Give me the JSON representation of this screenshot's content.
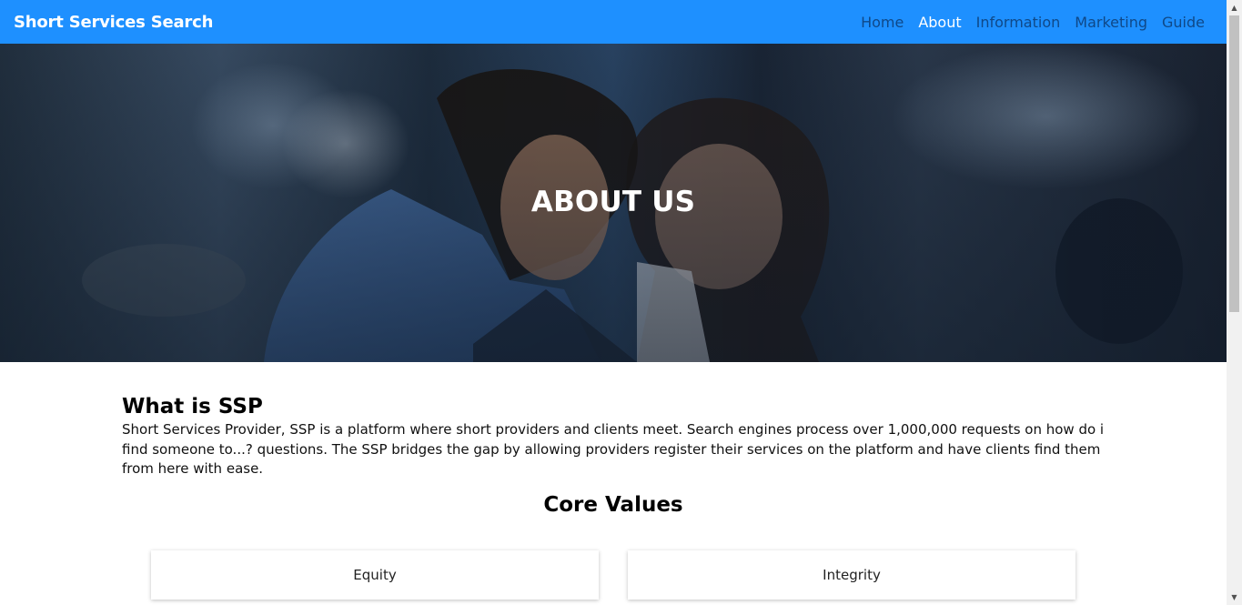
{
  "navbar": {
    "brand": "Short Services Search",
    "links": [
      {
        "label": "Home"
      },
      {
        "label": "About"
      },
      {
        "label": "Information"
      },
      {
        "label": "Marketing"
      },
      {
        "label": "Guide"
      }
    ],
    "active": "About",
    "bg_color": "#1e90ff"
  },
  "hero": {
    "title": "ABOUT US"
  },
  "about": {
    "heading": "What is SSP",
    "text": "Short Services Provider, SSP is a platform where short providers and clients meet. Search engines process over 1,000,000 requests on how do i find someone to...? questions. The SSP bridges the gap by allowing providers register their services on the platform and have clients find them from here with ease."
  },
  "core_values": {
    "heading": "Core Values",
    "items": [
      {
        "label": "Equity"
      },
      {
        "label": "Integrity"
      }
    ]
  }
}
